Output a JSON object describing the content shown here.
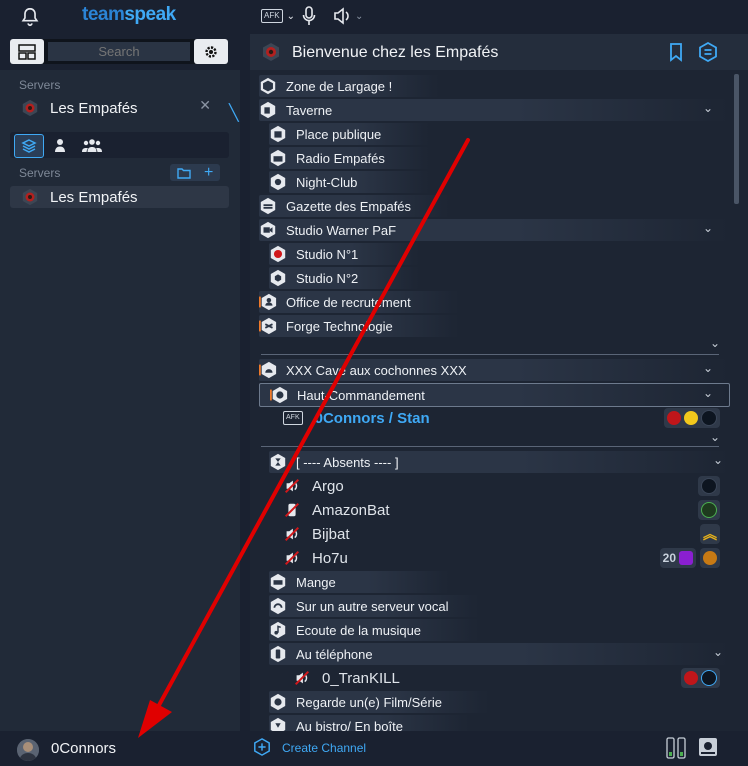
{
  "brand": {
    "team": "team",
    "speak": "speak"
  },
  "search": {
    "placeholder": "Search"
  },
  "sidebar": {
    "servers_label_top": "Servers",
    "server_top": "Les Empafés",
    "servers_label": "Servers",
    "server_item": "Les Empafés"
  },
  "user": {
    "name": "0Connors"
  },
  "header": {
    "title": "Bienvenue chez les Empafés"
  },
  "toolbar": {
    "afk": "AFK"
  },
  "tree": {
    "channels": [
      {
        "label": "Zone de Largage !"
      },
      {
        "label": "Taverne"
      },
      {
        "label": "Place publique"
      },
      {
        "label": "Radio Empafés"
      },
      {
        "label": "Night-Club"
      },
      {
        "label": "Gazette des Empafés"
      },
      {
        "label": "Studio Warner PaF"
      },
      {
        "label": "Studio N°1"
      },
      {
        "label": "Studio N°2"
      },
      {
        "label": "Office de recrutement"
      },
      {
        "label": "Forge Technologie"
      },
      {
        "label": "XXX Cave aux cochonnes XXX"
      },
      {
        "label": "Haut-Commandement"
      },
      {
        "label": "[ ---- Absents ---- ]"
      },
      {
        "label": "Mange"
      },
      {
        "label": "Sur un autre serveur vocal"
      },
      {
        "label": "Ecoute de la musique"
      },
      {
        "label": "Au téléphone"
      },
      {
        "label": "Regarde un(e) Film/Série"
      },
      {
        "label": "Au bistro/ En boîte"
      }
    ],
    "users": [
      {
        "name": "0Connors / Stan",
        "afk": "AFK"
      },
      {
        "name": "Argo"
      },
      {
        "name": "AmazonBat"
      },
      {
        "name": "Bijbat"
      },
      {
        "name": "Ho7u",
        "badge_text": "20"
      },
      {
        "name": "0_TranKILL"
      }
    ]
  },
  "footer": {
    "create_channel": "Create Channel"
  },
  "colors": {
    "accent": "#3fa9f5",
    "background": "#1d2533",
    "arrow": "#e00000"
  }
}
